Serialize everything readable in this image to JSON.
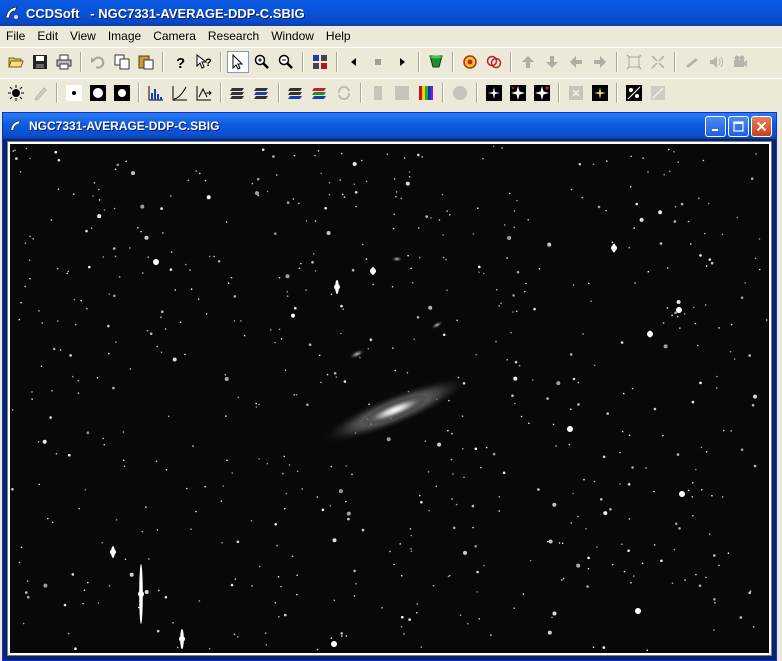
{
  "app": {
    "title": "CCDSoft   - NGC7331-AVERAGE-DDP-C.SBIG",
    "app_icon": "ccdsoft-logo-icon"
  },
  "menu": {
    "items": [
      "File",
      "Edit",
      "View",
      "Image",
      "Camera",
      "Research",
      "Window",
      "Help"
    ]
  },
  "toolbar1": {
    "buttons": [
      "open-icon",
      "save-icon",
      "print-icon",
      "undo-icon",
      "copy-icon",
      "paste-icon",
      "help-icon",
      "context-help-icon",
      "pointer-icon",
      "zoom-in-icon",
      "zoom-out-icon",
      "grid-icon",
      "previous-icon",
      "stop-icon",
      "next-icon",
      "filter-icon",
      "target-icon",
      "target-multi-icon",
      "arrow-up-icon",
      "arrow-down-icon",
      "arrow-left-icon",
      "arrow-right-icon",
      "fit-icon",
      "shrink-icon",
      "telescope-icon",
      "sound-icon",
      "camera-icon"
    ]
  },
  "toolbar2": {
    "buttons": [
      "brightness-icon",
      "wand-icon",
      "star-small-icon",
      "star-medium-icon",
      "star-large-icon",
      "histogram-icon",
      "curve-icon",
      "transform-icon",
      "stack-icon",
      "stack-color-icon",
      "stack-layers-icon",
      "stack-process-icon",
      "gray-bar-icon",
      "gray-square-icon",
      "color-spectrum-icon",
      "circle-icon",
      "star-field-icon",
      "star-burst-icon",
      "star-burst-red-icon",
      "gray-x-icon",
      "star-color-icon",
      "star-pair-icon",
      "gray-slash-icon"
    ]
  },
  "document": {
    "title": "NGC7331-AVERAGE-DDP-C.SBIG",
    "image_description_icon": "galaxy-image-icon"
  },
  "colors": {
    "titlebar": "#0855dd",
    "sky": "#080808",
    "chrome": "#ece9d8"
  }
}
